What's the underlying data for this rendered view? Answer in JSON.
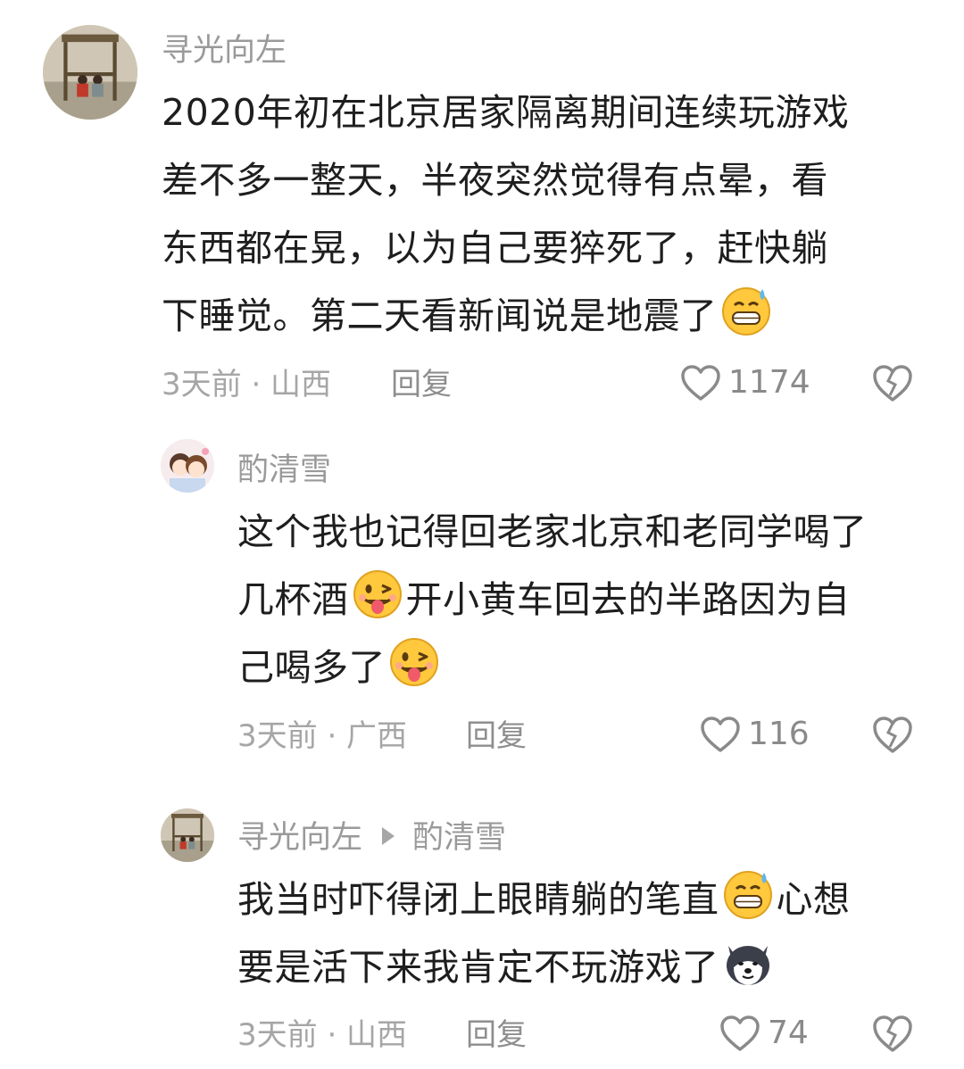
{
  "comments": [
    {
      "author": "寻光向左",
      "lines": [
        "2020年初在北京居家隔离期间连续玩游戏",
        "差不多一整天，半夜突然觉得有点晕，看",
        "东西都在晃，以为自己要猝死了，赶快躺",
        "下睡觉。第二天看新闻说是地震了"
      ],
      "time_location": "3天前 · 山西",
      "reply_label": "回复",
      "likes": "1174"
    },
    {
      "author": "酌清雪",
      "lines": [
        "这个我也记得回老家北京和老同学喝了",
        "几杯酒",
        "开小黄车回去的半路因为自",
        "己喝多了"
      ],
      "time_location": "3天前 · 广西",
      "reply_label": "回复",
      "likes": "116"
    },
    {
      "author": "寻光向左",
      "reply_to": "酌清雪",
      "lines": [
        "我当时吓得闭上眼睛躺的笔直",
        "心想",
        "要是活下来我肯定不玩游戏了"
      ],
      "time_location": "3天前 · 山西",
      "reply_label": "回复",
      "likes": "74"
    }
  ],
  "icons": {
    "like": "heart-outline-icon",
    "dislike": "broken-heart-icon",
    "emoji_sweat_grin": "grinning-sweat-emoji",
    "emoji_tongue_wink": "tongue-wink-emoji",
    "emoji_husky": "husky-dog-emoji",
    "reply_arrow": "reply-triangle-icon"
  },
  "colors": {
    "username": "#9a9a9a",
    "meta": "#a6a6a6",
    "body": "#1e1e1e",
    "icon": "#8a8a8a"
  }
}
